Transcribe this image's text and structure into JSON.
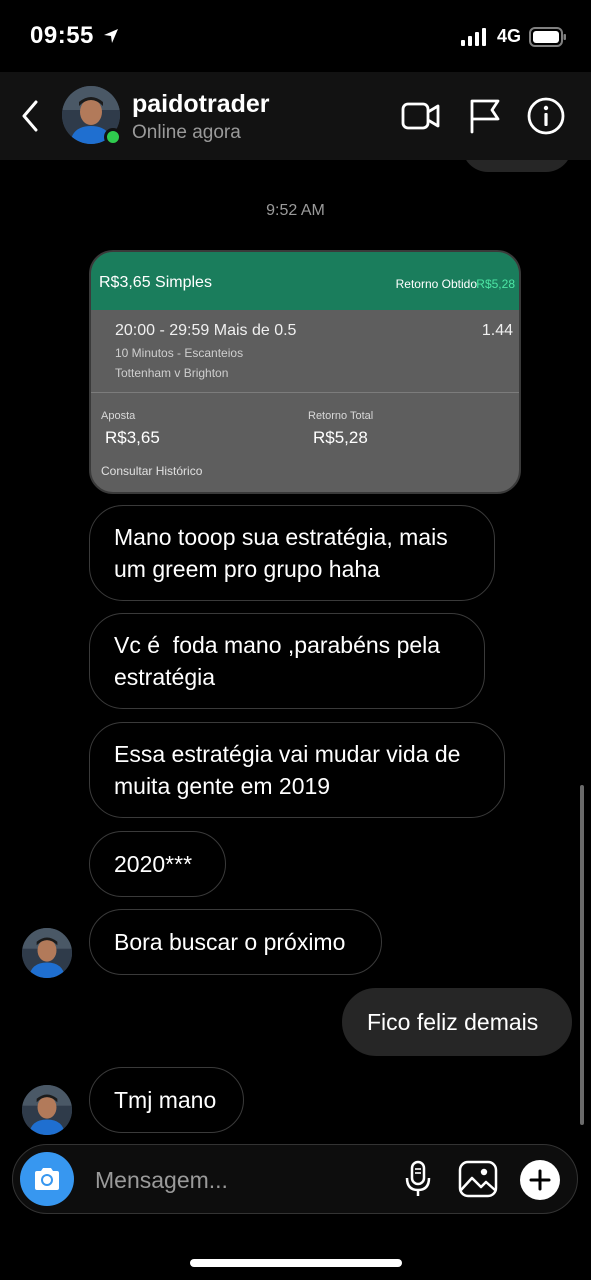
{
  "status_bar": {
    "time": "09:55",
    "network": "4G"
  },
  "header": {
    "username": "paidotrader",
    "status": "Online agora"
  },
  "chat": {
    "timestamp": "9:52 AM",
    "bet_card": {
      "title": "R$3,65 Simples",
      "return_label": "Retorno Obtido",
      "return_value": "R$5,28",
      "selection": "20:00 - 29:59 Mais de 0.5",
      "odds": "1.44",
      "market": "10 Minutos - Escanteios",
      "event": "Tottenham v Brighton",
      "stake_label": "Aposta",
      "stake_value": "R$3,65",
      "total_label": "Retorno Total",
      "total_value": "R$5,28",
      "history_link": "Consultar Histórico"
    },
    "messages": [
      {
        "sender": "me",
        "lines": [
          "Mano tooop sua estratégia, mais",
          "um greem pro grupo haha"
        ]
      },
      {
        "sender": "me",
        "lines": [
          "Vc é  foda mano ,parabéns pela",
          "estratégia"
        ]
      },
      {
        "sender": "me",
        "lines": [
          "Essa estratégia vai mudar vida de",
          "muita gente em 2019"
        ]
      },
      {
        "sender": "me",
        "lines": [
          "2020***"
        ]
      },
      {
        "sender": "paidotrader",
        "lines": [
          "Bora buscar o próximo"
        ]
      },
      {
        "sender": "me_sent",
        "lines": [
          "Fico feliz demais"
        ]
      },
      {
        "sender": "paidotrader",
        "lines": [
          "Tmj mano"
        ]
      }
    ]
  },
  "composer": {
    "placeholder": "Mensagem...",
    "icons": [
      "camera-icon",
      "microphone-icon",
      "gallery-icon",
      "add-icon"
    ]
  },
  "colors": {
    "bet_header": "#1a7d5c",
    "bet_return_accent": "#4ce6a4",
    "online_dot": "#2fcc4e",
    "camera_button": "#3797f0",
    "sent_bubble": "#262626"
  }
}
